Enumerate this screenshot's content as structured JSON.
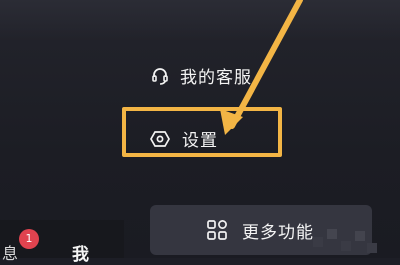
{
  "menu": {
    "customer_service_label": "我的客服",
    "settings_label": "设置"
  },
  "more_functions": {
    "label": "更多功能"
  },
  "bottom_tabs": {
    "partial_tab_label": "息",
    "badge_count": "1",
    "me_label": "我"
  },
  "colors": {
    "highlight": "#f3b545",
    "background": "#1d1e26",
    "button_bg": "#353640",
    "badge": "#e0434f"
  },
  "icons": [
    "headset-icon",
    "gear-icon",
    "grid-icon"
  ]
}
